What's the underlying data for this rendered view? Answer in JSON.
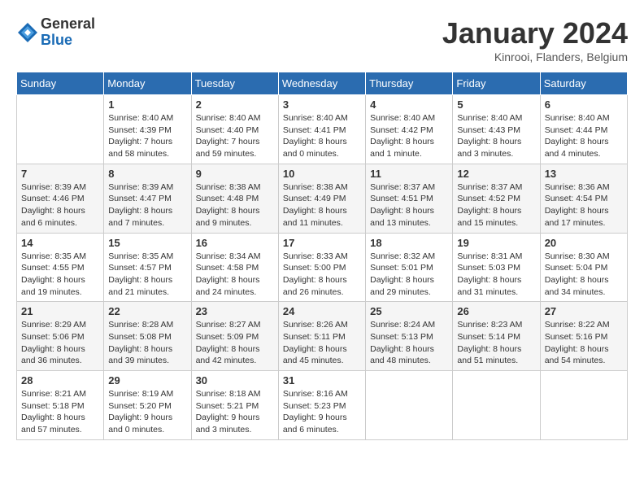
{
  "logo": {
    "general": "General",
    "blue": "Blue"
  },
  "title": "January 2024",
  "subtitle": "Kinrooi, Flanders, Belgium",
  "days_of_week": [
    "Sunday",
    "Monday",
    "Tuesday",
    "Wednesday",
    "Thursday",
    "Friday",
    "Saturday"
  ],
  "weeks": [
    [
      {
        "day": "",
        "info": ""
      },
      {
        "day": "1",
        "info": "Sunrise: 8:40 AM\nSunset: 4:39 PM\nDaylight: 7 hours\nand 58 minutes."
      },
      {
        "day": "2",
        "info": "Sunrise: 8:40 AM\nSunset: 4:40 PM\nDaylight: 7 hours\nand 59 minutes."
      },
      {
        "day": "3",
        "info": "Sunrise: 8:40 AM\nSunset: 4:41 PM\nDaylight: 8 hours\nand 0 minutes."
      },
      {
        "day": "4",
        "info": "Sunrise: 8:40 AM\nSunset: 4:42 PM\nDaylight: 8 hours\nand 1 minute."
      },
      {
        "day": "5",
        "info": "Sunrise: 8:40 AM\nSunset: 4:43 PM\nDaylight: 8 hours\nand 3 minutes."
      },
      {
        "day": "6",
        "info": "Sunrise: 8:40 AM\nSunset: 4:44 PM\nDaylight: 8 hours\nand 4 minutes."
      }
    ],
    [
      {
        "day": "7",
        "info": "Sunrise: 8:39 AM\nSunset: 4:46 PM\nDaylight: 8 hours\nand 6 minutes."
      },
      {
        "day": "8",
        "info": "Sunrise: 8:39 AM\nSunset: 4:47 PM\nDaylight: 8 hours\nand 7 minutes."
      },
      {
        "day": "9",
        "info": "Sunrise: 8:38 AM\nSunset: 4:48 PM\nDaylight: 8 hours\nand 9 minutes."
      },
      {
        "day": "10",
        "info": "Sunrise: 8:38 AM\nSunset: 4:49 PM\nDaylight: 8 hours\nand 11 minutes."
      },
      {
        "day": "11",
        "info": "Sunrise: 8:37 AM\nSunset: 4:51 PM\nDaylight: 8 hours\nand 13 minutes."
      },
      {
        "day": "12",
        "info": "Sunrise: 8:37 AM\nSunset: 4:52 PM\nDaylight: 8 hours\nand 15 minutes."
      },
      {
        "day": "13",
        "info": "Sunrise: 8:36 AM\nSunset: 4:54 PM\nDaylight: 8 hours\nand 17 minutes."
      }
    ],
    [
      {
        "day": "14",
        "info": "Sunrise: 8:35 AM\nSunset: 4:55 PM\nDaylight: 8 hours\nand 19 minutes."
      },
      {
        "day": "15",
        "info": "Sunrise: 8:35 AM\nSunset: 4:57 PM\nDaylight: 8 hours\nand 21 minutes."
      },
      {
        "day": "16",
        "info": "Sunrise: 8:34 AM\nSunset: 4:58 PM\nDaylight: 8 hours\nand 24 minutes."
      },
      {
        "day": "17",
        "info": "Sunrise: 8:33 AM\nSunset: 5:00 PM\nDaylight: 8 hours\nand 26 minutes."
      },
      {
        "day": "18",
        "info": "Sunrise: 8:32 AM\nSunset: 5:01 PM\nDaylight: 8 hours\nand 29 minutes."
      },
      {
        "day": "19",
        "info": "Sunrise: 8:31 AM\nSunset: 5:03 PM\nDaylight: 8 hours\nand 31 minutes."
      },
      {
        "day": "20",
        "info": "Sunrise: 8:30 AM\nSunset: 5:04 PM\nDaylight: 8 hours\nand 34 minutes."
      }
    ],
    [
      {
        "day": "21",
        "info": "Sunrise: 8:29 AM\nSunset: 5:06 PM\nDaylight: 8 hours\nand 36 minutes."
      },
      {
        "day": "22",
        "info": "Sunrise: 8:28 AM\nSunset: 5:08 PM\nDaylight: 8 hours\nand 39 minutes."
      },
      {
        "day": "23",
        "info": "Sunrise: 8:27 AM\nSunset: 5:09 PM\nDaylight: 8 hours\nand 42 minutes."
      },
      {
        "day": "24",
        "info": "Sunrise: 8:26 AM\nSunset: 5:11 PM\nDaylight: 8 hours\nand 45 minutes."
      },
      {
        "day": "25",
        "info": "Sunrise: 8:24 AM\nSunset: 5:13 PM\nDaylight: 8 hours\nand 48 minutes."
      },
      {
        "day": "26",
        "info": "Sunrise: 8:23 AM\nSunset: 5:14 PM\nDaylight: 8 hours\nand 51 minutes."
      },
      {
        "day": "27",
        "info": "Sunrise: 8:22 AM\nSunset: 5:16 PM\nDaylight: 8 hours\nand 54 minutes."
      }
    ],
    [
      {
        "day": "28",
        "info": "Sunrise: 8:21 AM\nSunset: 5:18 PM\nDaylight: 8 hours\nand 57 minutes."
      },
      {
        "day": "29",
        "info": "Sunrise: 8:19 AM\nSunset: 5:20 PM\nDaylight: 9 hours\nand 0 minutes."
      },
      {
        "day": "30",
        "info": "Sunrise: 8:18 AM\nSunset: 5:21 PM\nDaylight: 9 hours\nand 3 minutes."
      },
      {
        "day": "31",
        "info": "Sunrise: 8:16 AM\nSunset: 5:23 PM\nDaylight: 9 hours\nand 6 minutes."
      },
      {
        "day": "",
        "info": ""
      },
      {
        "day": "",
        "info": ""
      },
      {
        "day": "",
        "info": ""
      }
    ]
  ]
}
